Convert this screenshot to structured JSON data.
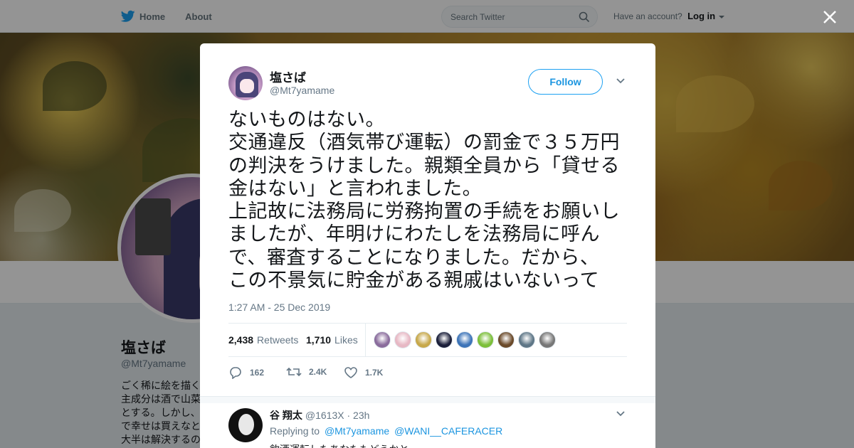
{
  "nav": {
    "home_label": "Home",
    "about_label": "About",
    "search_placeholder": "Search Twitter",
    "account_prompt": "Have an account?",
    "login_label": "Log in",
    "brand_color": "#1da1f2"
  },
  "profile": {
    "name": "塩さば",
    "handle": "@Mt7yamame",
    "bio": "ごく稀に絵を描く 主成分は酒で山菜 とする。しかし、 で幸せは買えなと 大半は解決するの"
  },
  "tweet": {
    "author_name": "塩さば",
    "author_handle": "@Mt7yamame",
    "follow_label": "Follow",
    "text_lines": [
      "ないものはない。",
      "交通違反（酒気帯び運転）の罰金で３５万円",
      "の判決をうけました。親類全員から「貸せる",
      "金はない」と言われました。",
      "上記故に法務局に労務拘置の手続をお願いし",
      "ましたが、年明けにわたしを法務局に呼ん",
      "で、審査することになりました。だから、",
      "この不景気に貯金がある親戚はいないって"
    ],
    "timestamp": "1:27 AM - 25 Dec 2019",
    "retweets_count": "2,438",
    "retweets_label": "Retweets",
    "likes_count": "1,710",
    "likes_label": "Likes",
    "likers": [
      {
        "color": "#8a6c9c",
        "icon": "avatar"
      },
      {
        "color": "#e7b8c4",
        "icon": "avatar"
      },
      {
        "color": "#c7a84a",
        "icon": "avatar"
      },
      {
        "color": "#1b1f3a",
        "icon": "avatar"
      },
      {
        "color": "#3d74b8",
        "icon": "avatar"
      },
      {
        "color": "#7cbf3a",
        "icon": "emoji-nauseated"
      },
      {
        "color": "#6b4a2a",
        "icon": "avatar"
      },
      {
        "color": "#5e7686",
        "icon": "avatar"
      },
      {
        "color": "#777777",
        "icon": "avatar"
      }
    ],
    "actions": {
      "reply_count": "162",
      "retweet_count": "2.4K",
      "like_count": "1.7K"
    }
  },
  "reply": {
    "author_name": "谷 翔太",
    "author_handle": "@1613X",
    "time": "· 23h",
    "replying_label": "Replying to",
    "mention_1": "@Mt7yamame",
    "mention_2": "@WANI__CAFERACER",
    "text": "飲酒運転したあなたもどうかと"
  }
}
